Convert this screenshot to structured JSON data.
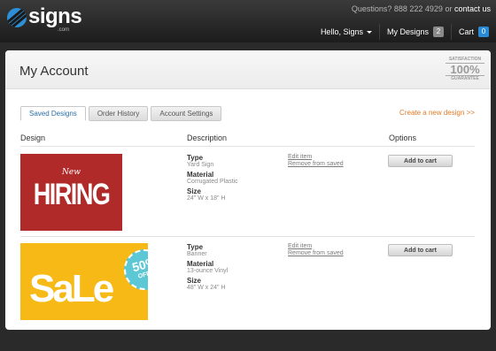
{
  "header": {
    "logo_text": "signs",
    "logo_suffix": ".com",
    "questions": "Questions? 888 222 4929 or",
    "contact": "contact us",
    "user_menu": "Hello, Signs",
    "my_designs": "My Designs",
    "my_designs_count": "2",
    "cart": "Cart",
    "cart_count": "0"
  },
  "page": {
    "title": "My Account",
    "guarantee": {
      "top": "SATISFACTION",
      "mid": "100%",
      "bottom": "GUARANTEE"
    }
  },
  "tabs": [
    "Saved Designs",
    "Order History",
    "Account Settings"
  ],
  "create_link": "Create a new design >>",
  "columns": {
    "design": "Design",
    "description": "Description",
    "options": "Options"
  },
  "designs": [
    {
      "thumb_small": "New",
      "thumb_big": "HIRING",
      "type_label": "Type",
      "type": "Yard Sign",
      "material_label": "Material",
      "material": "Corrugated Plastic",
      "size_label": "Size",
      "size": "24\" W x 18\" H",
      "edit": "Edit item",
      "remove": "Remove from saved",
      "add": "Add to cart"
    },
    {
      "thumb_big": "SaLe",
      "thumb_pct": "50%",
      "thumb_off": "OFF",
      "type_label": "Type",
      "type": "Banner",
      "material_label": "Material",
      "material": "13-ounce Vinyl",
      "size_label": "Size",
      "size": "48\" W x 24\" H",
      "edit": "Edit item",
      "remove": "Remove from saved",
      "add": "Add to cart"
    }
  ],
  "colors": {
    "accent_blue": "#2b8ad5",
    "link_orange": "#e07b2a",
    "hiring_red": "#b02a2a",
    "sale_yellow": "#f6b915"
  }
}
